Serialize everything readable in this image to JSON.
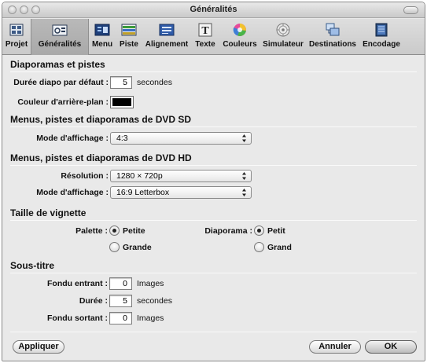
{
  "window": {
    "title": "Généralités"
  },
  "toolbar": {
    "items": [
      {
        "label": "Projet",
        "icon": "project-icon"
      },
      {
        "label": "Généralités",
        "icon": "general-icon",
        "selected": true
      },
      {
        "label": "Menu",
        "icon": "menu-icon"
      },
      {
        "label": "Piste",
        "icon": "track-icon"
      },
      {
        "label": "Alignement",
        "icon": "alignment-icon"
      },
      {
        "label": "Texte",
        "icon": "text-icon"
      },
      {
        "label": "Couleurs",
        "icon": "colors-icon"
      },
      {
        "label": "Simulateur",
        "icon": "simulator-icon"
      },
      {
        "label": "Destinations",
        "icon": "destinations-icon"
      },
      {
        "label": "Encodage",
        "icon": "encoding-icon"
      }
    ]
  },
  "slideshows": {
    "title": "Diaporamas et pistes",
    "duration_label": "Durée diapo par défaut :",
    "duration_value": "5",
    "duration_unit": "secondes",
    "bg_color_label": "Couleur d'arrière-plan :",
    "bg_color": "#000000"
  },
  "sd": {
    "title": "Menus, pistes et diaporamas de DVD SD",
    "display_mode_label": "Mode d'affichage :",
    "display_mode_value": "4:3"
  },
  "hd": {
    "title": "Menus, pistes et diaporamas de DVD HD",
    "resolution_label": "Résolution :",
    "resolution_value": "1280 × 720p",
    "display_mode_label": "Mode d'affichage :",
    "display_mode_value": "16:9 Letterbox"
  },
  "thumbnail": {
    "title": "Taille de vignette",
    "palette_label": "Palette :",
    "palette_small": "Petite",
    "palette_large": "Grande",
    "palette_selected": "Petite",
    "slideshow_label": "Diaporama :",
    "slideshow_small": "Petit",
    "slideshow_large": "Grand",
    "slideshow_selected": "Petit"
  },
  "subtitle": {
    "title": "Sous-titre",
    "fade_in_label": "Fondu entrant :",
    "fade_in_value": "0",
    "fade_in_unit": "Images",
    "duration_label": "Durée :",
    "duration_value": "5",
    "duration_unit": "secondes",
    "fade_out_label": "Fondu sortant :",
    "fade_out_value": "0",
    "fade_out_unit": "Images"
  },
  "buttons": {
    "apply": "Appliquer",
    "cancel": "Annuler",
    "ok": "OK"
  },
  "colors": {
    "selected_tab": "#ababab",
    "background": "#e9e9e9"
  }
}
